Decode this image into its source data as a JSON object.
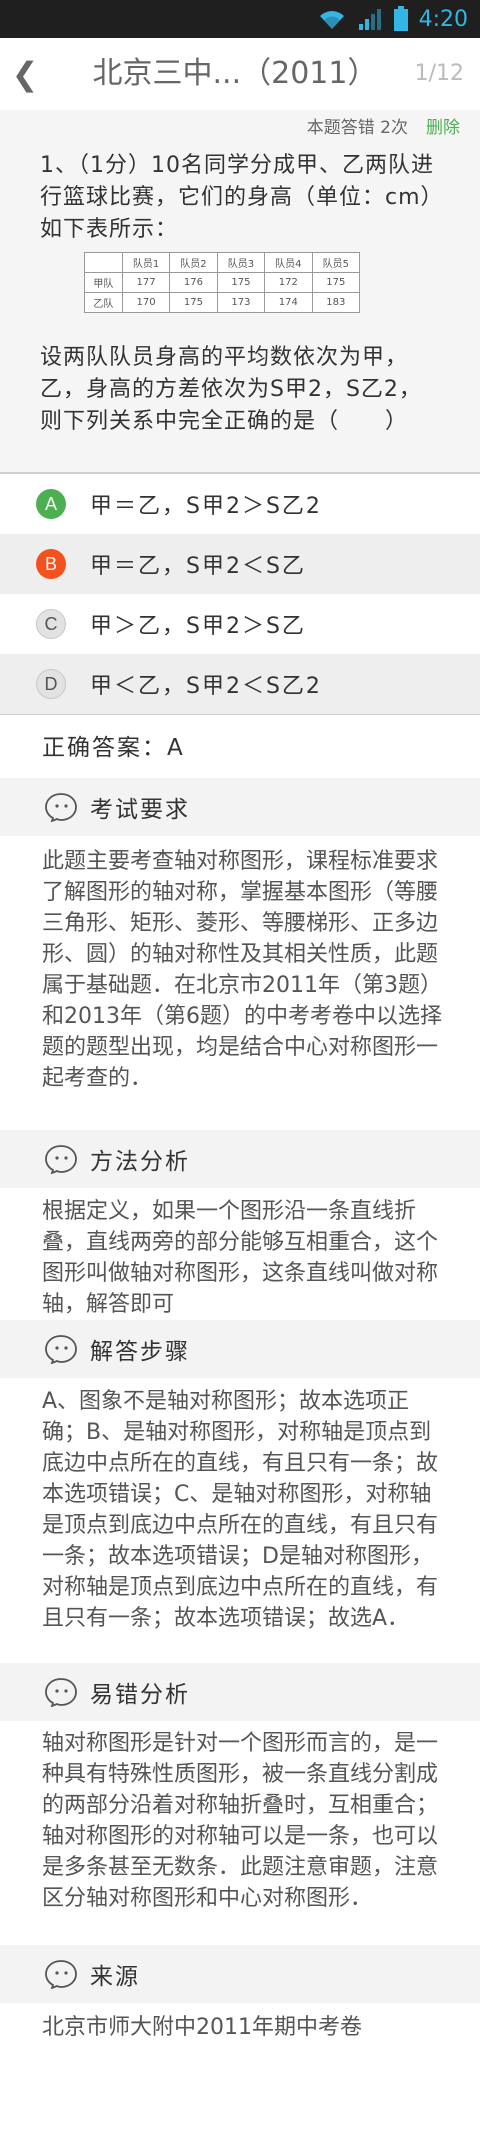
{
  "status_bar": {
    "time": "4:20",
    "icons": [
      "wifi-icon",
      "signal-icon",
      "battery-icon"
    ]
  },
  "header": {
    "back_icon": "chevron-left-icon",
    "title": "北京三中...（2011）",
    "page": "1/12"
  },
  "question": {
    "meta": {
      "wrong_count_label": "本题答错 2次",
      "delete_label": "删除"
    },
    "text_part1": "1、（1分）10名同学分成甲、乙两队进行篮球比赛，它们的身高（单位：cm）如下表所示：",
    "table": {
      "headers": [
        "",
        "队员1",
        "队员2",
        "队员3",
        "队员4",
        "队员5"
      ],
      "rows": [
        [
          "甲队",
          "177",
          "176",
          "175",
          "172",
          "175"
        ],
        [
          "乙队",
          "170",
          "175",
          "173",
          "174",
          "183"
        ]
      ]
    },
    "text_part2": "设两队队员身高的平均数依次为甲，乙，身高的方差依次为S甲2，S乙2，则下列关系中完全正确的是（　　）"
  },
  "options": [
    {
      "letter": "A",
      "text": "甲＝乙，S甲2＞S乙2",
      "state": "correct"
    },
    {
      "letter": "B",
      "text": "甲＝乙，S甲2＜S乙",
      "state": "wrong"
    },
    {
      "letter": "C",
      "text": "甲＞乙，S甲2＞S乙",
      "state": "none"
    },
    {
      "letter": "D",
      "text": "甲＜乙，S甲2＜S乙2",
      "state": "none"
    }
  ],
  "answer": {
    "text": "正确答案：A"
  },
  "sections": [
    {
      "icon": "face-icon",
      "title": "考试要求",
      "body": "此题主要考查轴对称图形，课程标准要求了解图形的轴对称，掌握基本图形（等腰三角形、矩形、菱形、等腰梯形、正多边形、圆）的轴对称性及其相关性质，此题属于基础题．在北京市2011年（第3题）和2013年（第6题）的中考考卷中以选择题的题型出现，均是结合中心对称图形一起考查的．"
    },
    {
      "icon": "face-icon",
      "title": "方法分析",
      "body": "根据定义，如果一个图形沿一条直线折叠，直线两旁的部分能够互相重合，这个图形叫做轴对称图形，这条直线叫做对称轴，解答即可"
    },
    {
      "icon": "face-icon",
      "title": "解答步骤",
      "body": "A、图象不是轴对称图形；故本选项正确；B、是轴对称图形，对称轴是顶点到底边中点所在的直线，有且只有一条；故本选项错误；C、是轴对称图形，对称轴是顶点到底边中点所在的直线，有且只有一条；故本选项错误；D是轴对称图形，对称轴是顶点到底边中点所在的直线，有且只有一条；故本选项错误；故选A．"
    },
    {
      "icon": "face-icon",
      "title": "易错分析",
      "body": "轴对称图形是针对一个图形而言的，是一种具有特殊性质图形，被一条直线分割成的两部分沿着对称轴折叠时，互相重合；轴对称图形的对称轴可以是一条，也可以是多条甚至无数条．此题注意审题，注意区分轴对称图形和中心对称图形．"
    },
    {
      "icon": "face-icon",
      "title": "来源",
      "body": "北京市师大附中2011年期中考卷"
    }
  ],
  "colors": {
    "correct": "#4caf50",
    "wrong": "#f4511e",
    "accent": "#33b5e5",
    "delete": "#4caf50"
  }
}
